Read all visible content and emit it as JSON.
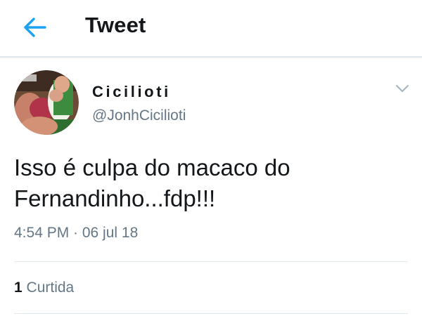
{
  "header": {
    "back_icon": "arrow-left-icon",
    "title": "Tweet"
  },
  "tweet": {
    "display_name": "Cicilioti",
    "handle": "@JonhCicilioti",
    "menu_icon": "chevron-down-icon",
    "text": "Isso é culpa do macaco do Fernandinho...fdp!!!",
    "timestamp": "4:54 PM · 06 jul 18",
    "likes_count": "1",
    "likes_label": "Curtida"
  },
  "colors": {
    "accent": "#1da1f2",
    "text_primary": "#14171a",
    "text_secondary": "#657786",
    "divider": "#e1e8ed"
  }
}
